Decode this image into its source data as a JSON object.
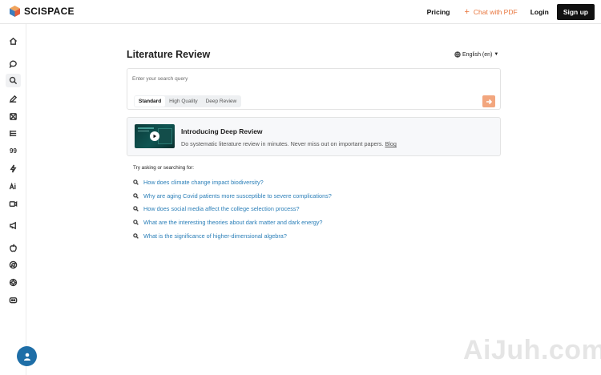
{
  "brand": {
    "name": "SCISPACE",
    "colors": {
      "accent": "#e8743b",
      "primary_dark": "#111111",
      "link": "#2b7fb8",
      "help": "#1e6ea7"
    }
  },
  "nav": {
    "pricing": "Pricing",
    "chat_pdf": "Chat with PDF",
    "login": "Login",
    "signup": "Sign up"
  },
  "sidebar": {
    "items": [
      {
        "icon": "home-icon"
      },
      {
        "icon": "chat-icon"
      },
      {
        "icon": "search-icon"
      },
      {
        "icon": "pen-icon"
      },
      {
        "icon": "grid-icon"
      },
      {
        "icon": "list-icon"
      },
      {
        "icon": "quote-icon",
        "glyph": "99"
      },
      {
        "icon": "bolt-icon"
      },
      {
        "icon": "ai-writer-icon"
      },
      {
        "icon": "video-icon"
      },
      {
        "icon": "megaphone-icon"
      },
      {
        "icon": "apple-icon"
      },
      {
        "icon": "chrome-icon"
      },
      {
        "icon": "openai-icon"
      },
      {
        "icon": "discord-icon"
      }
    ]
  },
  "main": {
    "title": "Literature Review",
    "language": "English (en)",
    "search": {
      "placeholder": "Enter your search query",
      "value": ""
    },
    "modes": [
      "Standard",
      "High Quality",
      "Deep Review"
    ],
    "selected_mode": "Standard",
    "promo": {
      "title": "Introducing Deep Review",
      "description": "Do systematic literature review in minutes. Never miss out on important papers.",
      "link": "Blog"
    },
    "try_label": "Try asking or searching for:",
    "suggestions": [
      "How does climate change impact biodiversity?",
      "Why are aging Covid patients more susceptible to severe complications?",
      "How does social media affect the college selection process?",
      "What are the interesting theories about dark matter and dark energy?",
      "What is the significance of higher-dimensional algebra?"
    ]
  },
  "watermark": "AiJuh.com"
}
